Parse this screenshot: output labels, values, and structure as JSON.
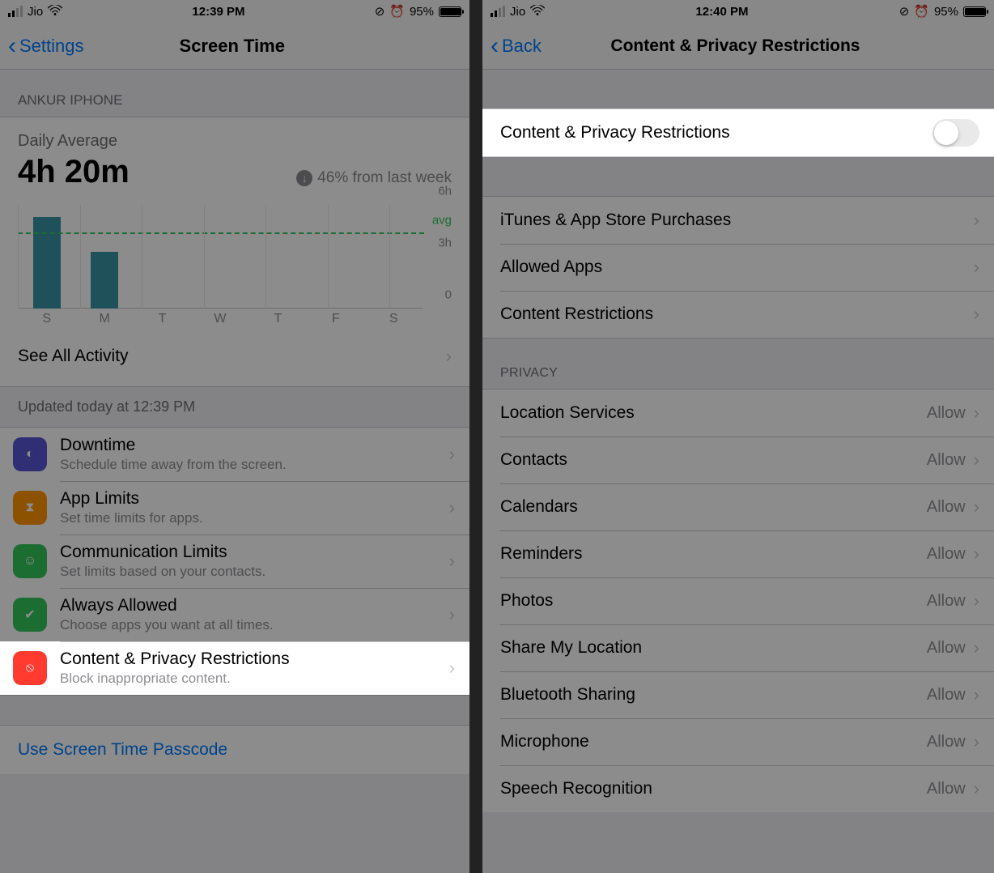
{
  "left": {
    "status": {
      "carrier": "Jio",
      "time": "12:39 PM",
      "battery": "95%"
    },
    "nav": {
      "back": "Settings",
      "title": "Screen Time"
    },
    "section_header": "ANKUR IPHONE",
    "daily_average": {
      "label": "Daily Average",
      "value": "4h 20m",
      "trend": "46% from last week"
    },
    "chart_row": {
      "see_all": "See All Activity",
      "updated": "Updated today at 12:39 PM"
    },
    "options": [
      {
        "title": "Downtime",
        "subtitle": "Schedule time away from the screen.",
        "icon": "downtime"
      },
      {
        "title": "App Limits",
        "subtitle": "Set time limits for apps.",
        "icon": "applimits"
      },
      {
        "title": "Communication Limits",
        "subtitle": "Set limits based on your contacts.",
        "icon": "comm"
      },
      {
        "title": "Always Allowed",
        "subtitle": "Choose apps you want at all times.",
        "icon": "always"
      },
      {
        "title": "Content & Privacy Restrictions",
        "subtitle": "Block inappropriate content.",
        "icon": "content"
      }
    ],
    "passcode_link": "Use Screen Time Passcode"
  },
  "right": {
    "status": {
      "carrier": "Jio",
      "time": "12:40 PM",
      "battery": "95%"
    },
    "nav": {
      "back": "Back",
      "title": "Content & Privacy Restrictions"
    },
    "toggle_label": "Content & Privacy Restrictions",
    "group1": [
      "iTunes & App Store Purchases",
      "Allowed Apps",
      "Content Restrictions"
    ],
    "privacy_header": "PRIVACY",
    "privacy_items": [
      {
        "label": "Location Services",
        "value": "Allow"
      },
      {
        "label": "Contacts",
        "value": "Allow"
      },
      {
        "label": "Calendars",
        "value": "Allow"
      },
      {
        "label": "Reminders",
        "value": "Allow"
      },
      {
        "label": "Photos",
        "value": "Allow"
      },
      {
        "label": "Share My Location",
        "value": "Allow"
      },
      {
        "label": "Bluetooth Sharing",
        "value": "Allow"
      },
      {
        "label": "Microphone",
        "value": "Allow"
      },
      {
        "label": "Speech Recognition",
        "value": "Allow"
      }
    ]
  },
  "chart_data": {
    "type": "bar",
    "title": "Daily Average 4h 20m",
    "categories": [
      "S",
      "M",
      "T",
      "W",
      "T",
      "F",
      "S"
    ],
    "values": [
      5.3,
      3.3,
      0,
      0,
      0,
      0,
      0
    ],
    "ylabel": "hours",
    "yticks": [
      0,
      3,
      6
    ],
    "avg": 4.33,
    "ylim": [
      0,
      6
    ]
  }
}
